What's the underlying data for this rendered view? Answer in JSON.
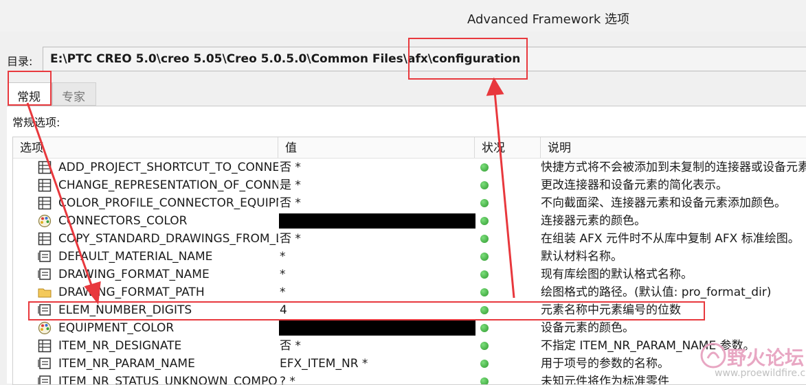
{
  "window": {
    "title": "Advanced Framework 选项"
  },
  "directory": {
    "label": "目录:",
    "path": "E:\\PTC CREO 5.0\\creo 5.05\\Creo 5.0.5.0\\Common Files\\afx\\configuration"
  },
  "tabs": [
    {
      "label": "常规",
      "active": true
    },
    {
      "label": "专家",
      "active": false
    }
  ],
  "section_label": "常规选项:",
  "columns": [
    "选项",
    "值",
    "状况",
    "说明"
  ],
  "rows": [
    {
      "name": "ADD_PROJECT_SHORTCUT_TO_CONNECTORS",
      "value": "否 *",
      "icon": "list-icon",
      "description": "快捷方式将不会被添加到未复制的连接器或设备元素"
    },
    {
      "name": "CHANGE_REPRESENTATION_OF_CONNECTORS",
      "value": "是 *",
      "icon": "list-icon",
      "description": "更改连接器和设备元素的简化表示。"
    },
    {
      "name": "COLOR_PROFILE_CONNECTOR_EQUIPMENT",
      "value": "否 *",
      "icon": "list-icon",
      "description": "不向截面梁、连接器元素和设备元素添加颜色。"
    },
    {
      "name": "CONNECTORS_COLOR",
      "value": "",
      "icon": "palette-icon",
      "redacted": true,
      "description": "连接器元素的颜色。"
    },
    {
      "name": "COPY_STANDARD_DRAWINGS_FROM_LIBRARY",
      "value": "否 *",
      "icon": "list-icon",
      "description": "在组装 AFX 元件时不从库中复制 AFX 标准绘图。"
    },
    {
      "name": "DEFAULT_MATERIAL_NAME",
      "value": " *",
      "icon": "text-field-icon",
      "description": "默认材料名称。"
    },
    {
      "name": "DRAWING_FORMAT_NAME",
      "value": " *",
      "icon": "text-field-icon",
      "description": "现有库绘图的默认格式名称。"
    },
    {
      "name": "DRAWING_FORMAT_PATH",
      "value": " *",
      "icon": "folder-icon",
      "description": "绘图格式的路径。(默认值: pro_format_dir)"
    },
    {
      "name": "ELEM_NUMBER_DIGITS",
      "value": "4",
      "icon": "text-field-icon",
      "description": "元素名称中元素编号的位数"
    },
    {
      "name": "EQUIPMENT_COLOR",
      "value": "",
      "icon": "palette-icon",
      "redacted": true,
      "description": "设备元素的颜色。"
    },
    {
      "name": "ITEM_NR_DESIGNATE",
      "value": "否 *",
      "icon": "list-icon",
      "description": "不指定 ITEM_NR_PARAM_NAME 参数。"
    },
    {
      "name": "ITEM_NR_PARAM_NAME",
      "value": "EFX_ITEM_NR *",
      "icon": "text-field-icon",
      "description": "用于项号的参数的名称。"
    },
    {
      "name": "ITEM_NR_STATUS_UNKNOWN_COMPONENTS",
      "value": "? *",
      "icon": "text-field-icon",
      "description": "未知元件将作为标准零件"
    }
  ],
  "watermark": {
    "text": "野火论坛",
    "url": "www.proewildfire.cn"
  },
  "colors": {
    "annotation": "#e8383d",
    "status_ok": "#3fae3f"
  }
}
